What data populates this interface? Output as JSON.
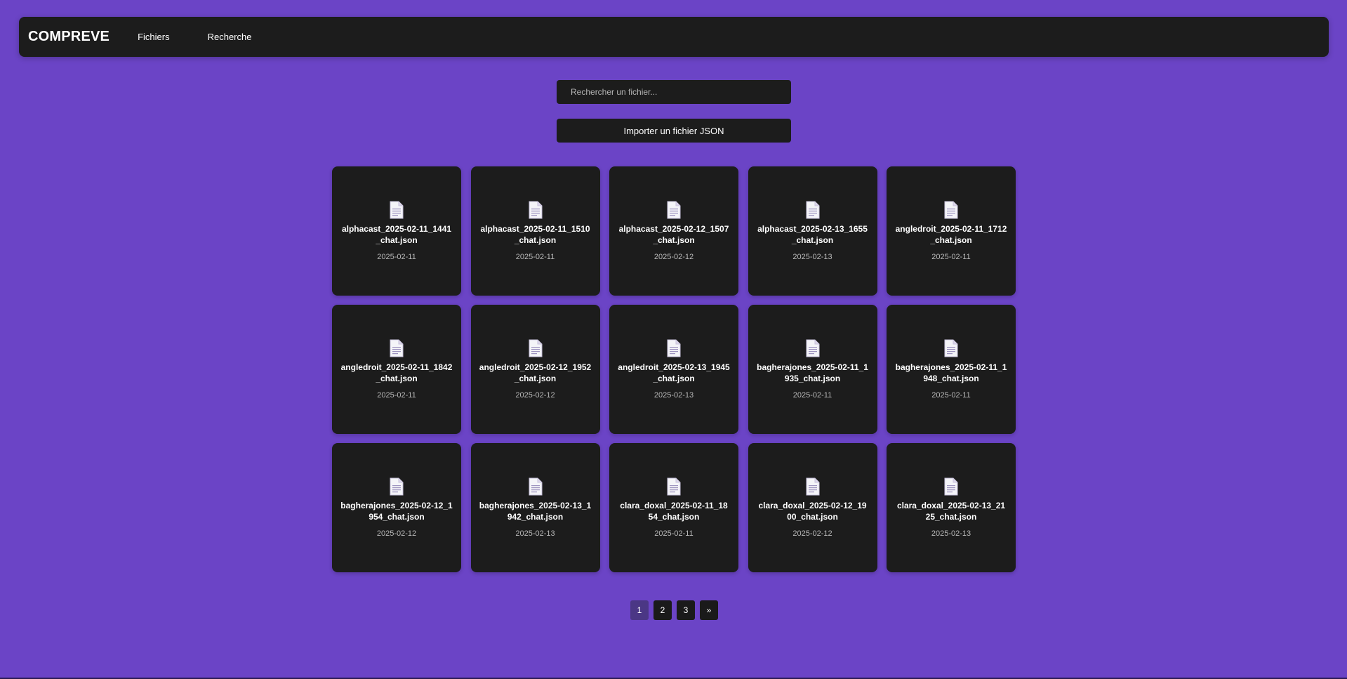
{
  "navbar": {
    "brand": "COMPREVE",
    "links": [
      "Fichiers",
      "Recherche"
    ]
  },
  "search": {
    "placeholder": "Rechercher un fichier..."
  },
  "import_button": {
    "label": "Importer un fichier JSON"
  },
  "files": [
    {
      "name": "alphacast_2025-02-11_1441_chat.json",
      "date": "2025-02-11"
    },
    {
      "name": "alphacast_2025-02-11_1510_chat.json",
      "date": "2025-02-11"
    },
    {
      "name": "alphacast_2025-02-12_1507_chat.json",
      "date": "2025-02-12"
    },
    {
      "name": "alphacast_2025-02-13_1655_chat.json",
      "date": "2025-02-13"
    },
    {
      "name": "angledroit_2025-02-11_1712_chat.json",
      "date": "2025-02-11"
    },
    {
      "name": "angledroit_2025-02-11_1842_chat.json",
      "date": "2025-02-11"
    },
    {
      "name": "angledroit_2025-02-12_1952_chat.json",
      "date": "2025-02-12"
    },
    {
      "name": "angledroit_2025-02-13_1945_chat.json",
      "date": "2025-02-13"
    },
    {
      "name": "bagherajones_2025-02-11_1935_chat.json",
      "date": "2025-02-11"
    },
    {
      "name": "bagherajones_2025-02-11_1948_chat.json",
      "date": "2025-02-11"
    },
    {
      "name": "bagherajones_2025-02-12_1954_chat.json",
      "date": "2025-02-12"
    },
    {
      "name": "bagherajones_2025-02-13_1942_chat.json",
      "date": "2025-02-13"
    },
    {
      "name": "clara_doxal_2025-02-11_1854_chat.json",
      "date": "2025-02-11"
    },
    {
      "name": "clara_doxal_2025-02-12_1900_chat.json",
      "date": "2025-02-12"
    },
    {
      "name": "clara_doxal_2025-02-13_2125_chat.json",
      "date": "2025-02-13"
    }
  ],
  "pagination": {
    "pages": [
      "1",
      "2",
      "3"
    ],
    "current": "1",
    "next_label": "»"
  },
  "colors": {
    "background": "#6b44c6",
    "panel": "#1c1c1c",
    "active_page": "#4b3785"
  },
  "icons": {
    "file": "file-icon"
  }
}
